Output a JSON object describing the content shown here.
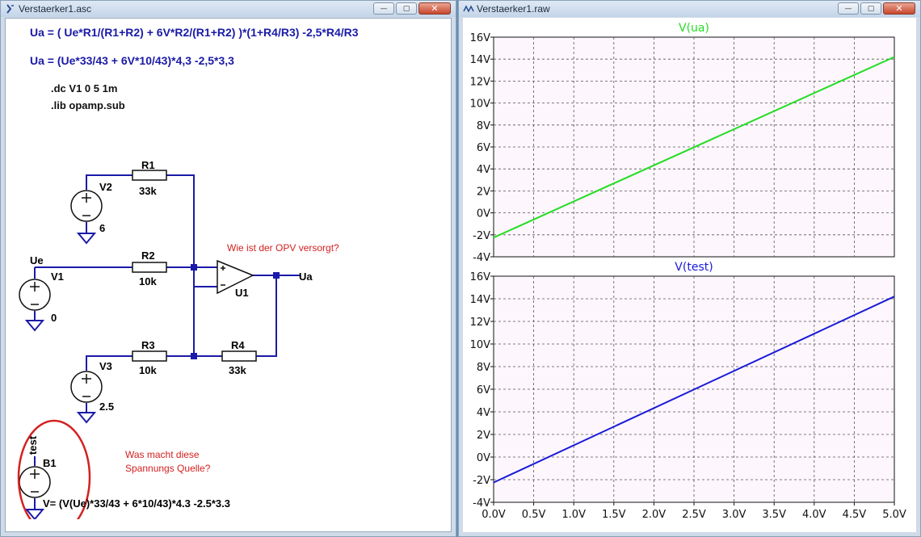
{
  "schematic_window": {
    "title": "Verstaerker1.asc",
    "formula1": "Ua =  ( Ue*R1/(R1+R2) + 6V*R2/(R1+R2) )*(1+R4/R3) -2,5*R4/R3",
    "formula2": "Ua = (Ue*33/43 + 6V*10/43)*4,3 -2,5*3,3",
    "directive_dc": ".dc V1 0 5 1m",
    "directive_lib": ".lib opamp.sub",
    "components": {
      "r1_name": "R1",
      "r1_value": "33k",
      "r2_name": "R2",
      "r2_value": "10k",
      "r3_name": "R3",
      "r3_value": "10k",
      "r4_name": "R4",
      "r4_value": "33k",
      "v1_name": "V1",
      "v1_value": "0",
      "v2_name": "V2",
      "v2_value": "6",
      "v3_name": "V3",
      "v3_value": "2.5",
      "u1_name": "U1",
      "b1_name": "B1",
      "b1_expr": "V= (V(Ue)*33/43 + 6*10/43)*4.3 -2.5*3.3",
      "net_ue": "Ue",
      "net_ua": "Ua",
      "net_test": "test"
    },
    "annotation_opv": "Wie ist der OPV versorgt?",
    "annotation_source_l1": "Was macht diese",
    "annotation_source_l2": "Spannungs Quelle?"
  },
  "plot_window": {
    "title": "Verstaerker1.raw",
    "pane_top_title": "V(ua)",
    "pane_bottom_title": "V(test)",
    "y_ticks": [
      "16V",
      "14V",
      "12V",
      "10V",
      "8V",
      "6V",
      "4V",
      "2V",
      "0V",
      "-2V",
      "-4V"
    ],
    "x_ticks": [
      "0.0V",
      "0.5V",
      "1.0V",
      "1.5V",
      "2.0V",
      "2.5V",
      "3.0V",
      "3.5V",
      "4.0V",
      "4.5V",
      "5.0V"
    ]
  },
  "window_controls": {
    "minimize": "—",
    "maximize": "▢",
    "close": "✕"
  },
  "colors": {
    "trace_ua": "#22dd22",
    "trace_test": "#1a1ad8",
    "wire": "#1a1aa8",
    "annotation": "#d42020",
    "grid_bg": "#fdf6fd"
  },
  "chart_data": [
    {
      "type": "line",
      "title": "V(ua)",
      "x": [
        0,
        5
      ],
      "series": [
        {
          "name": "V(ua)",
          "values": [
            -2.25,
            14.2
          ]
        }
      ],
      "xlim": [
        0,
        5
      ],
      "ylim": [
        -4,
        16
      ],
      "grid": true
    },
    {
      "type": "line",
      "title": "V(test)",
      "x": [
        0,
        5
      ],
      "series": [
        {
          "name": "V(test)",
          "values": [
            -2.25,
            14.2
          ]
        }
      ],
      "xlim": [
        0,
        5
      ],
      "ylim": [
        -4,
        16
      ],
      "grid": true
    }
  ]
}
